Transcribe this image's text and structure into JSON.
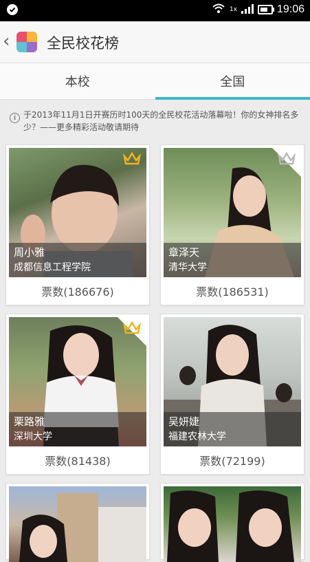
{
  "status_bar": {
    "time": "19:06",
    "network_label": "1x"
  },
  "header": {
    "title": "全民校花榜"
  },
  "tabs": [
    {
      "label": "本校",
      "active": false
    },
    {
      "label": "全国",
      "active": true
    }
  ],
  "notice": {
    "text": "于2013年11月1日开赛历时100天的全民校花活动落幕啦！你的女神排名多少？——更多精彩活动敬请期待"
  },
  "entries": [
    {
      "name": "周小雅",
      "school": "成都信息工程学院",
      "votes": "票数(186676)",
      "crown": "gold"
    },
    {
      "name": "章泽天",
      "school": "清华大学",
      "votes": "票数(186531)",
      "crown": "silver"
    },
    {
      "name": "栗路雅",
      "school": "深圳大学",
      "votes": "票数(81438)",
      "crown": "gold"
    },
    {
      "name": "吴妍婕",
      "school": "福建农林大学",
      "votes": "票数(72199)",
      "crown": "none"
    }
  ],
  "colors": {
    "accent": "#3fb6c6",
    "gold_crown": "#f2b41c",
    "silver_crown": "#b8b8b8"
  }
}
